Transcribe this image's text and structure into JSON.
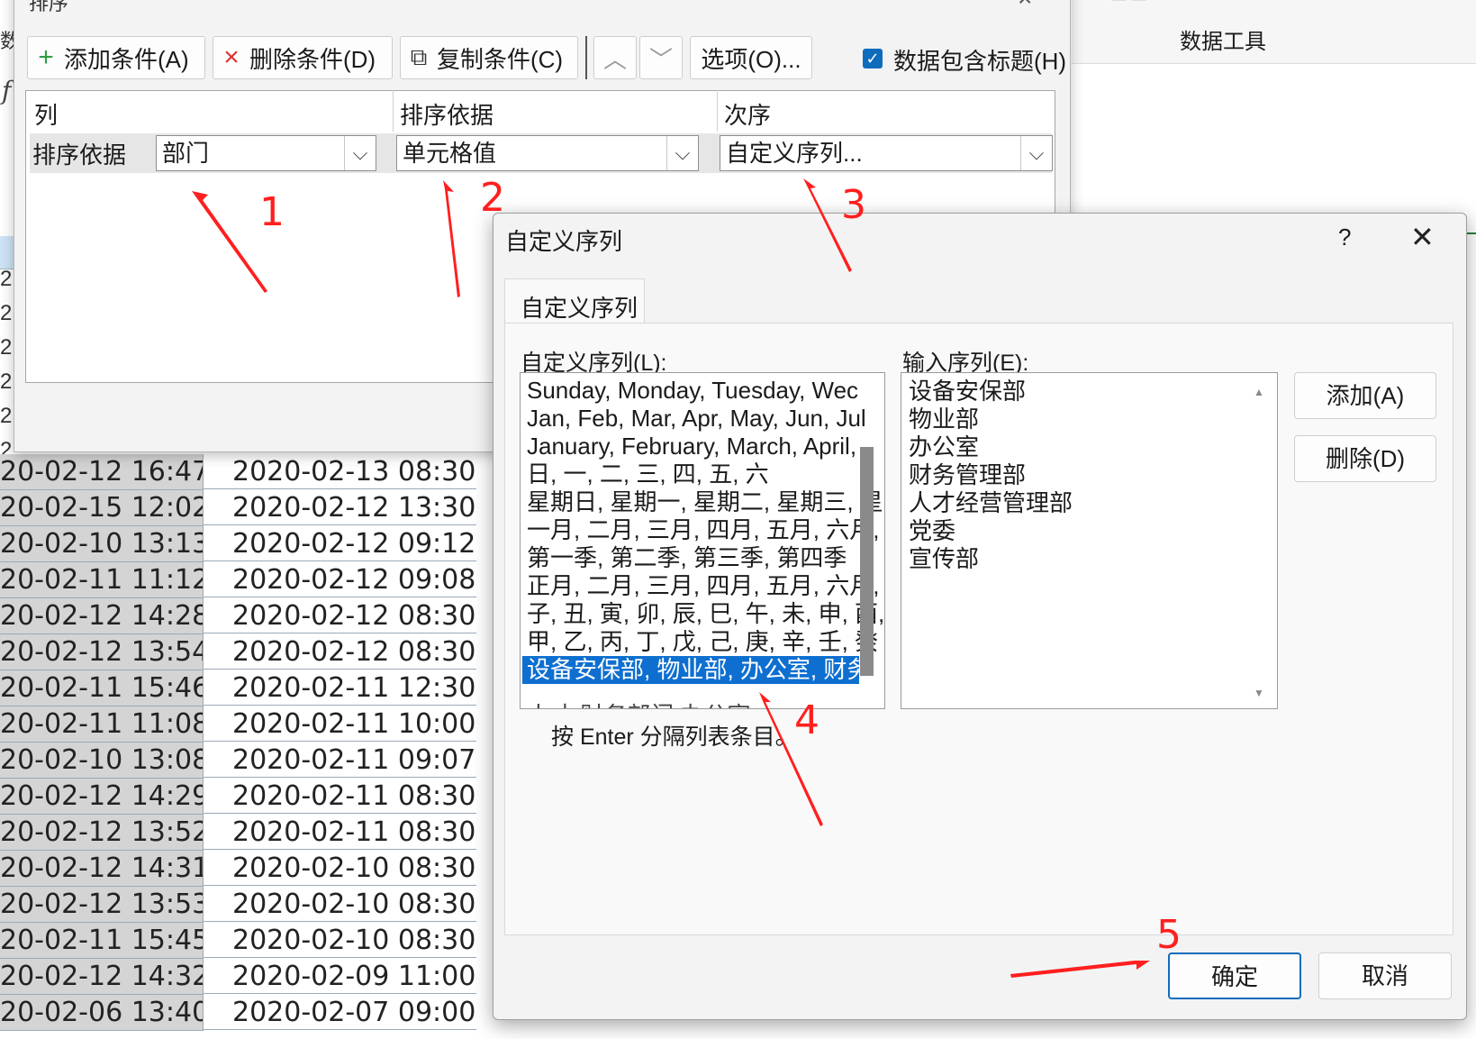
{
  "background": {
    "ribbon_group_label": "数据工具",
    "ribbon_top_text": "─ ─",
    "ribbon_left_fragment": "数",
    "fx_fragment": "f",
    "row_fragments": [
      "2",
      "2",
      "2",
      "2",
      "2",
      "2"
    ],
    "rows": [
      {
        "a": "20-02-12 16:47",
        "b": "2020-02-13 08:30"
      },
      {
        "a": "20-02-15 12:02",
        "b": "2020-02-12 13:30"
      },
      {
        "a": "20-02-10 13:13",
        "b": "2020-02-12 09:12"
      },
      {
        "a": "20-02-11 11:12",
        "b": "2020-02-12 09:08"
      },
      {
        "a": "20-02-12 14:28",
        "b": "2020-02-12 08:30"
      },
      {
        "a": "20-02-12 13:54",
        "b": "2020-02-12 08:30"
      },
      {
        "a": "20-02-11 15:46",
        "b": "2020-02-11 12:30"
      },
      {
        "a": "20-02-11 11:08",
        "b": "2020-02-11 10:00"
      },
      {
        "a": "20-02-10 13:08",
        "b": "2020-02-11 09:07"
      },
      {
        "a": "20-02-12 14:29",
        "b": "2020-02-11 08:30"
      },
      {
        "a": "20-02-12 13:52",
        "b": "2020-02-11 08:30"
      },
      {
        "a": "20-02-12 14:31",
        "b": "2020-02-10 08:30"
      },
      {
        "a": "20-02-12 13:53",
        "b": "2020-02-10 08:30"
      },
      {
        "a": "20-02-11 15:45",
        "b": "2020-02-10 08:30"
      },
      {
        "a": "20-02-12 14:32",
        "b": "2020-02-09 11:00"
      },
      {
        "a": "20-02-06 13:40",
        "b": "2020-02-07 09:00"
      }
    ]
  },
  "sort_dialog": {
    "title": "排序",
    "close_icon": "×",
    "toolbar": {
      "add_icon": "+",
      "add_label": "添加条件(A)",
      "delete_icon": "×",
      "delete_label": "删除条件(D)",
      "copy_icon": "⧉",
      "copy_label": "复制条件(C)",
      "up_icon": "︿",
      "down_icon": "﹀",
      "options_label": "选项(O)...",
      "has_header_checked": true,
      "has_header_check": "✓",
      "has_header_label": "数据包含标题(H)"
    },
    "grid": {
      "col_header": "列",
      "sort_on_header": "排序依据",
      "order_header": "次序",
      "row_label": "排序依据",
      "column_value": "部门",
      "sort_on_value": "单元格值",
      "order_value": "自定义序列...",
      "dropdown_arrow": "⌵"
    }
  },
  "custom_list_dialog": {
    "title": "自定义序列",
    "help": "?",
    "close": "✕",
    "tab_label": "自定义序列",
    "lists_label": "自定义序列(L):",
    "entries_label": "输入序列(E):",
    "lists": [
      "Sunday, Monday, Tuesday, Wec",
      "Jan, Feb, Mar, Apr, May, Jun, Jul",
      "January, February, March, April,",
      "日, 一, 二, 三, 四, 五, 六",
      "星期日, 星期一, 星期二, 星期三, 星",
      "一月, 二月, 三月, 四月, 五月, 六月,",
      "第一季, 第二季, 第三季, 第四季",
      "正月, 二月, 三月, 四月, 五月, 六月,",
      "子, 丑, 寅, 卯, 辰, 巳, 午, 未, 申, 酉,",
      "甲, 乙, 丙, 丁, 戊, 己, 庚, 辛, 壬, 癸"
    ],
    "selected_list": "设备安保部, 物业部, 办公室, 财务管",
    "list_cut_fragment": "人才 财务部门 办公室",
    "entries": [
      "设备安保部",
      "物业部",
      "办公室",
      "财务管理部",
      "人才经营管理部",
      "党委",
      "宣传部"
    ],
    "scroll_up": "▲",
    "scroll_down": "▼",
    "add_button": "添加(A)",
    "delete_button": "删除(D)",
    "hint": "按 Enter 分隔列表条目。",
    "ok_button": "确定",
    "cancel_button": "取消"
  },
  "annotations": {
    "labels": [
      "1",
      "2",
      "3",
      "4",
      "5"
    ],
    "color": "#ff1f1f"
  }
}
